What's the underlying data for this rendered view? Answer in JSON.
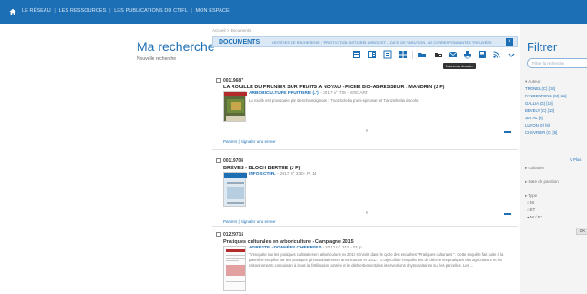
{
  "topnav": {
    "items": [
      "LE RÉSEAU",
      "LES RESSOURCES",
      "LES PUBLICATIONS DU CTIFL",
      "MON ESPACE"
    ],
    "sep": "|"
  },
  "left": {
    "title": "Ma recherche",
    "new_search": "Nouvelle recherche"
  },
  "breadcrumb": "Accueil > Documents",
  "doc_header": {
    "title": "DOCUMENTS",
    "filters": "CRITÈRES DE RECHERCHE : \"PROTECTION INTÉGRÉE ARBOCET\" - DATE DE PARUTION - 42 CORRESPONDANTES TROUVÉES",
    "close": "×"
  },
  "toolbar": {
    "tooltip": "Nouveau dossier"
  },
  "results": [
    {
      "id": "00119687",
      "title": "LA ROUILLE DU PRUNIER SUR FRUITS A NOYAU - FICHE BIO-AGRESSEUR : MANDRIN (J F)",
      "subtitle": "ARBORICULTURE FRUITIERE (L')",
      "meta": "- 2017 n° 705 - ENCART",
      "desc": "La rouille est provoquée par des champignons : Tranzschelia pruni-spinosae et Tranzschelia discolor.",
      "actions": "Paniers | Signaler une erreur"
    },
    {
      "id": "00119708",
      "title": "BRÈVES - BLOCH BERTHE (J F)",
      "subtitle": "INFOS CTIFL",
      "meta": "- 2017 n° 330 - P. 14",
      "desc": "",
      "actions": "Paniers | Signaler une erreur"
    },
    {
      "id": "01229716",
      "title": "Pratiques culturales en arboriculture - Campagne 2015",
      "subtitle": "AGRESTE - DONNÉES CHIFFRÉES",
      "meta": "- 2017 n° 343 - 53 p.",
      "desc": "\"L'enquête sur les pratiques culturales en arboriculture en 2015 s'inscrit dans le cycle des enquêtes \"Pratiques culturales \". Cette enquête fait suite à la première enquête sur les pratiques phytosanitaires en arboriculture en 2012.\" L'objectif de l'enquête est de décrire les pratiques des agriculteurs et les raisonnements conduisant à leurs la fertilisation azotée et le désherbement des interventions phytosanitaires sur les parcelles. Les ...",
      "actions": ""
    }
  ],
  "filter": {
    "title": "Filtrer",
    "search_placeholder": "Filtrer la recherche",
    "auteur_head": "▾ Auteur",
    "auteurs": [
      "TRONEL (C) [18]",
      "FANDENTONG (M) [11]",
      "GALLIA (G) [10]",
      "BEVELY (C) [10]",
      "JET AL [6]",
      "LUYON (J) [6]",
      "CHEVRIER (C) [5]"
    ],
    "more": "V Plus",
    "collation_head": "▸ Collation",
    "date_head": "▸ Date de parution",
    "type_head": "▸ Type",
    "types": [
      "○ NI",
      "○ ET",
      "● NI / ET"
    ],
    "ok": "OK"
  },
  "colors": {
    "brand": "#1d6fb5",
    "header_bg": "#dbe9f6",
    "filter_bg": "#f4f4f4"
  }
}
